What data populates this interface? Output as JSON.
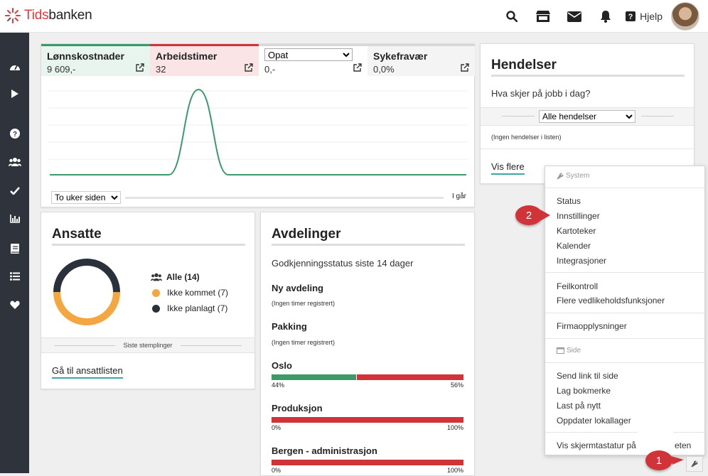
{
  "app": {
    "name_prefix": "Tids",
    "name_suffix": "banken"
  },
  "header": {
    "help_label": "Hjelp"
  },
  "kpis": [
    {
      "title": "Lønnskostnader",
      "value": "9 609,-",
      "color": "#3a9a6c"
    },
    {
      "title": "Arbeidstimer",
      "value": "32",
      "color": "#d13438"
    },
    {
      "select_value": "Opat",
      "value": "0,-",
      "color": "#d8d8d8"
    },
    {
      "title": "Sykefravær",
      "value": "0,0%",
      "color": "#d8d8d8"
    }
  ],
  "chart": {
    "range_select": "To uker siden",
    "end_label": "I går"
  },
  "chart_data": {
    "type": "line",
    "x": [
      0,
      1,
      2,
      3,
      4,
      5,
      6,
      7,
      8,
      9,
      10,
      11,
      12,
      13,
      14
    ],
    "values": [
      0,
      0,
      0,
      0,
      0,
      9.6,
      0,
      0,
      0,
      0,
      0,
      0,
      0,
      0,
      0
    ],
    "xlabel": "",
    "ylabel": "",
    "grid": true,
    "color": "#3a9a6c"
  },
  "hendelser": {
    "title": "Hendelser",
    "prompt": "Hva skjer på jobb i dag?",
    "filter": "Alle hendelser",
    "empty": "(Ingen hendelser i listen)",
    "more": "Vis flere"
  },
  "ansatte": {
    "title": "Ansatte",
    "legend": [
      {
        "label": "Alle (14)",
        "color": "#333"
      },
      {
        "label": "Ikke kommet (7)",
        "color": "#f4a640"
      },
      {
        "label": "Ikke planlagt (7)",
        "color": "#2b313a"
      }
    ],
    "donut": {
      "ikke_kommet": 7,
      "ikke_planlagt": 7
    },
    "divider": "Siste stemplinger",
    "link": "Gå til ansattlisten"
  },
  "avdelinger": {
    "title": "Avdelinger",
    "subtitle": "Godkjenningsstatus siste 14 dager",
    "items": [
      {
        "name": "Ny avdeling",
        "note": "(Ingen timer registrert)"
      },
      {
        "name": "Pakking",
        "note": "(Ingen timer registrert)"
      },
      {
        "name": "Oslo",
        "left": "44%",
        "right": "56%",
        "fraction": 0.44
      },
      {
        "name": "Produksjon",
        "left": "0%",
        "right": "100%",
        "fraction": 0
      },
      {
        "name": "Bergen - administrasjon",
        "left": "0%",
        "right": "100%",
        "fraction": 0
      }
    ],
    "green": "#3a9a6c",
    "red": "#d13438"
  },
  "menu": {
    "system_header": "System",
    "group1": [
      "Status",
      "Innstillinger",
      "Kartoteker",
      "Kalender",
      "Integrasjoner"
    ],
    "group2": [
      "Feilkontroll",
      "Flere vedlikeholdsfunksjoner"
    ],
    "group3": [
      "Firmaopplysninger"
    ],
    "side_header": "Side",
    "group4": [
      "Send link til side",
      "Lag bokmerke",
      "Last på nytt",
      "Oppdater lokallager"
    ],
    "group5": [
      "Vis skjermtastatur på",
      "eten"
    ]
  },
  "callouts": [
    "1",
    "2"
  ]
}
